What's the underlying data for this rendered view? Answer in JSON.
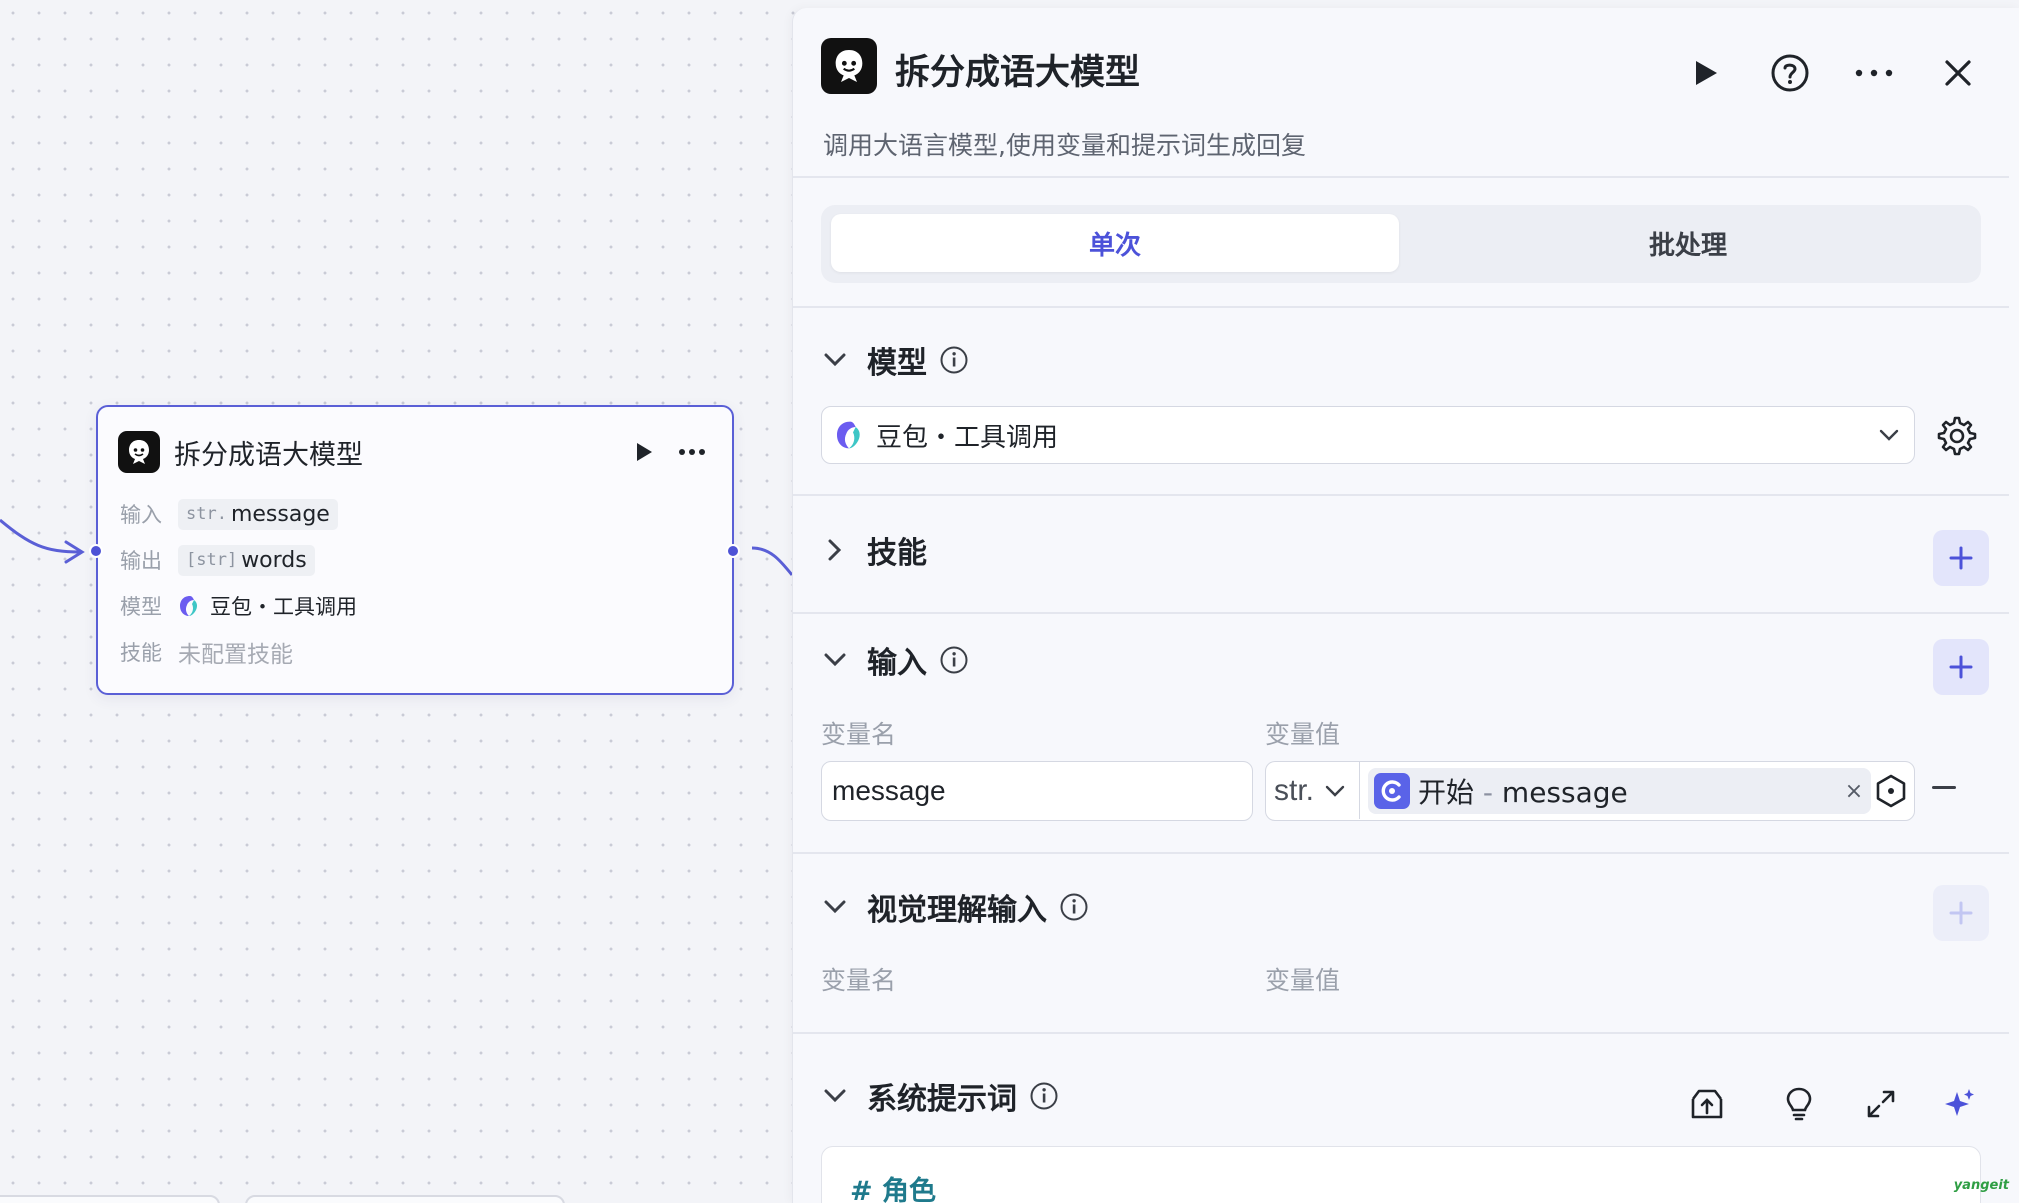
{
  "canvas": {
    "node": {
      "title": "拆分成语大模型",
      "input": {
        "label": "输入",
        "type": "str.",
        "value": "message"
      },
      "output": {
        "label": "输出",
        "type": "[str]",
        "value": "words"
      },
      "model": {
        "label": "模型",
        "value": "豆包・工具调用"
      },
      "skill": {
        "label": "技能",
        "value": "未配置技能"
      }
    }
  },
  "panel": {
    "title": "拆分成语大模型",
    "description": "调用大语言模型,使用变量和提示词生成回复",
    "tabs": [
      "单次",
      "批处理"
    ],
    "model_section": {
      "title": "模型",
      "selected": "豆包・工具调用"
    },
    "skill_section": {
      "title": "技能"
    },
    "input_section": {
      "title": "输入",
      "col_name": "变量名",
      "col_value": "变量值",
      "row": {
        "name": "message",
        "type": "str.",
        "ref_node": "开始",
        "ref_sep": " - ",
        "ref_var": "message",
        "clear": "×"
      }
    },
    "vision_section": {
      "title": "视觉理解输入",
      "col_name": "变量名",
      "col_value": "变量值"
    },
    "system_prompt_section": {
      "title": "系统提示词",
      "first_line": "# 角色"
    }
  },
  "watermark": "yangeit",
  "colors": {
    "accent": "#4c52d9",
    "node_border": "#5a5fd6",
    "panel_bg": "#f7f8fc"
  }
}
